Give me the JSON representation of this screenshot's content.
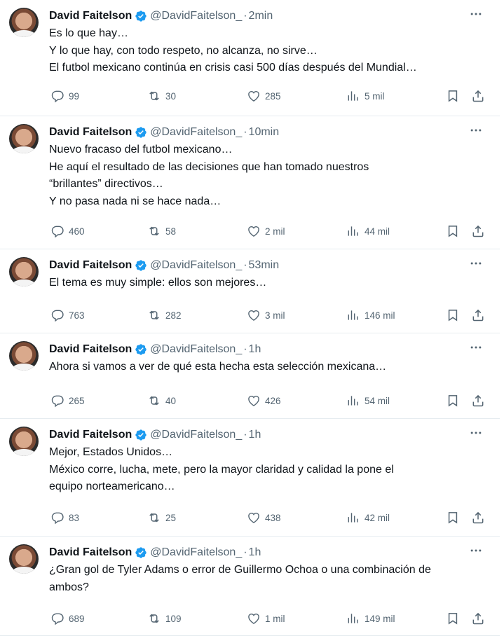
{
  "tweets": [
    {
      "name": "David Faitelson",
      "handle": "@DavidFaitelson_",
      "separator": "·",
      "time": "2min",
      "lines": [
        "Es lo que hay…",
        "Y lo que hay, con todo respeto, no alcanza, no sirve…",
        "El futbol mexicano continúa en crisis casi 500 días después del Mundial…"
      ],
      "replies": "99",
      "retweets": "30",
      "likes": "285",
      "views": "5 mil"
    },
    {
      "name": "David Faitelson",
      "handle": "@DavidFaitelson_",
      "separator": "·",
      "time": "10min",
      "lines": [
        "Nuevo fracaso del futbol mexicano…",
        "He aquí el resultado de las decisiones que han tomado nuestros",
        "“brillantes” directivos…",
        "Y no pasa nada ni se hace nada…"
      ],
      "replies": "460",
      "retweets": "58",
      "likes": "2 mil",
      "views": "44 mil"
    },
    {
      "name": "David Faitelson",
      "handle": "@DavidFaitelson_",
      "separator": "·",
      "time": "53min",
      "lines": [
        "El tema es muy simple: ellos son mejores…"
      ],
      "replies": "763",
      "retweets": "282",
      "likes": "3 mil",
      "views": "146 mil"
    },
    {
      "name": "David Faitelson",
      "handle": "@DavidFaitelson_",
      "separator": "·",
      "time": "1h",
      "lines": [
        "Ahora si vamos a ver de qué esta hecha esta selección mexicana…"
      ],
      "replies": "265",
      "retweets": "40",
      "likes": "426",
      "views": "54 mil"
    },
    {
      "name": "David Faitelson",
      "handle": "@DavidFaitelson_",
      "separator": "·",
      "time": "1h",
      "lines": [
        "Mejor, Estados Unidos…",
        "México corre, lucha, mete, pero la mayor claridad y calidad la pone el",
        "equipo norteamericano…"
      ],
      "replies": "83",
      "retweets": "25",
      "likes": "438",
      "views": "42 mil"
    },
    {
      "name": "David Faitelson",
      "handle": "@DavidFaitelson_",
      "separator": "·",
      "time": "1h",
      "lines": [
        "¿Gran gol de Tyler Adams o error de Guillermo Ochoa o una combinación de",
        "ambos?"
      ],
      "replies": "689",
      "retweets": "109",
      "likes": "1 mil",
      "views": "149 mil"
    }
  ],
  "icons": {
    "verified": "verified-badge-icon",
    "more": "more-options-icon",
    "reply": "reply-icon",
    "retweet": "retweet-icon",
    "like": "like-icon",
    "views": "views-icon",
    "bookmark": "bookmark-icon",
    "share": "share-icon"
  },
  "colors": {
    "verified_badge": "#1d9bf0",
    "secondary_text": "#536471",
    "primary_text": "#0f1419"
  }
}
